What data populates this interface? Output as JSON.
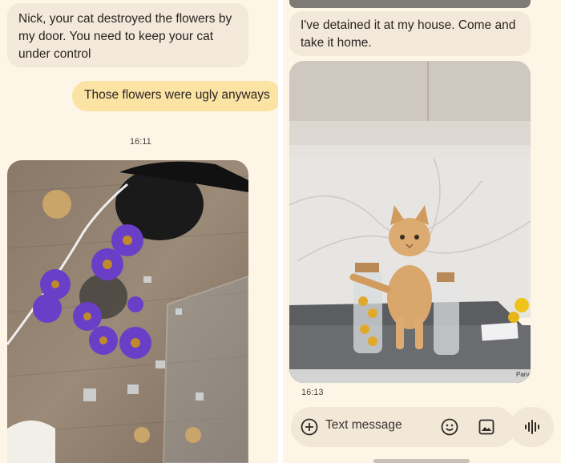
{
  "left": {
    "messages": [
      {
        "text": "Nick, your cat destroyed the flowers by\nmy door. You need to keep your cat\nunder control"
      },
      {
        "text": "Those flowers were ugly anyways"
      }
    ],
    "timestamp": "16:11"
  },
  "right": {
    "message": "I've detained it at my house. Come and\ntake it home.",
    "timestamp": "16:13",
    "compose": {
      "placeholder": "Text message",
      "icons": [
        "plus-icon",
        "emoji-icon",
        "gallery-icon",
        "voice-icon"
      ]
    },
    "photo_label": "Pana"
  },
  "colors": {
    "background": "#fdf5e6",
    "incoming_bubble": "#f3e9da",
    "outgoing_bubble": "#fbe3a3"
  }
}
